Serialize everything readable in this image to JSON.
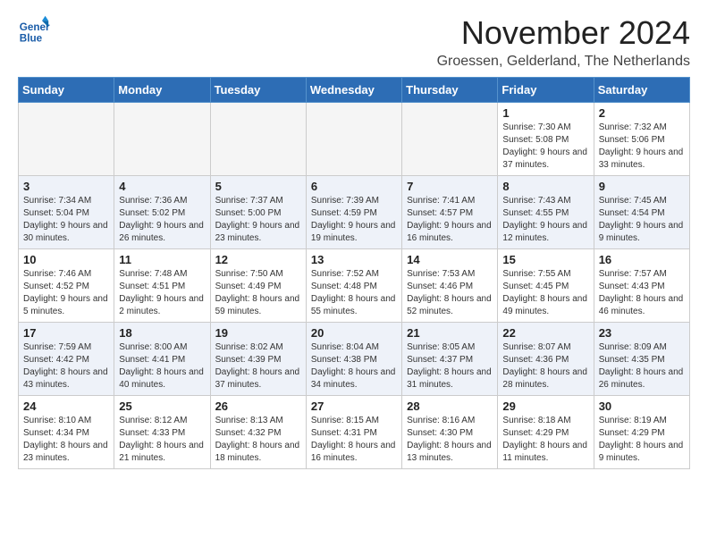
{
  "header": {
    "logo_line1": "General",
    "logo_line2": "Blue",
    "month_title": "November 2024",
    "location": "Groessen, Gelderland, The Netherlands"
  },
  "days_of_week": [
    "Sunday",
    "Monday",
    "Tuesday",
    "Wednesday",
    "Thursday",
    "Friday",
    "Saturday"
  ],
  "weeks": [
    [
      {
        "day": "",
        "empty": true
      },
      {
        "day": "",
        "empty": true
      },
      {
        "day": "",
        "empty": true
      },
      {
        "day": "",
        "empty": true
      },
      {
        "day": "",
        "empty": true
      },
      {
        "day": "1",
        "sunrise": "Sunrise: 7:30 AM",
        "sunset": "Sunset: 5:08 PM",
        "daylight": "Daylight: 9 hours and 37 minutes."
      },
      {
        "day": "2",
        "sunrise": "Sunrise: 7:32 AM",
        "sunset": "Sunset: 5:06 PM",
        "daylight": "Daylight: 9 hours and 33 minutes."
      }
    ],
    [
      {
        "day": "3",
        "sunrise": "Sunrise: 7:34 AM",
        "sunset": "Sunset: 5:04 PM",
        "daylight": "Daylight: 9 hours and 30 minutes."
      },
      {
        "day": "4",
        "sunrise": "Sunrise: 7:36 AM",
        "sunset": "Sunset: 5:02 PM",
        "daylight": "Daylight: 9 hours and 26 minutes."
      },
      {
        "day": "5",
        "sunrise": "Sunrise: 7:37 AM",
        "sunset": "Sunset: 5:00 PM",
        "daylight": "Daylight: 9 hours and 23 minutes."
      },
      {
        "day": "6",
        "sunrise": "Sunrise: 7:39 AM",
        "sunset": "Sunset: 4:59 PM",
        "daylight": "Daylight: 9 hours and 19 minutes."
      },
      {
        "day": "7",
        "sunrise": "Sunrise: 7:41 AM",
        "sunset": "Sunset: 4:57 PM",
        "daylight": "Daylight: 9 hours and 16 minutes."
      },
      {
        "day": "8",
        "sunrise": "Sunrise: 7:43 AM",
        "sunset": "Sunset: 4:55 PM",
        "daylight": "Daylight: 9 hours and 12 minutes."
      },
      {
        "day": "9",
        "sunrise": "Sunrise: 7:45 AM",
        "sunset": "Sunset: 4:54 PM",
        "daylight": "Daylight: 9 hours and 9 minutes."
      }
    ],
    [
      {
        "day": "10",
        "sunrise": "Sunrise: 7:46 AM",
        "sunset": "Sunset: 4:52 PM",
        "daylight": "Daylight: 9 hours and 5 minutes."
      },
      {
        "day": "11",
        "sunrise": "Sunrise: 7:48 AM",
        "sunset": "Sunset: 4:51 PM",
        "daylight": "Daylight: 9 hours and 2 minutes."
      },
      {
        "day": "12",
        "sunrise": "Sunrise: 7:50 AM",
        "sunset": "Sunset: 4:49 PM",
        "daylight": "Daylight: 8 hours and 59 minutes."
      },
      {
        "day": "13",
        "sunrise": "Sunrise: 7:52 AM",
        "sunset": "Sunset: 4:48 PM",
        "daylight": "Daylight: 8 hours and 55 minutes."
      },
      {
        "day": "14",
        "sunrise": "Sunrise: 7:53 AM",
        "sunset": "Sunset: 4:46 PM",
        "daylight": "Daylight: 8 hours and 52 minutes."
      },
      {
        "day": "15",
        "sunrise": "Sunrise: 7:55 AM",
        "sunset": "Sunset: 4:45 PM",
        "daylight": "Daylight: 8 hours and 49 minutes."
      },
      {
        "day": "16",
        "sunrise": "Sunrise: 7:57 AM",
        "sunset": "Sunset: 4:43 PM",
        "daylight": "Daylight: 8 hours and 46 minutes."
      }
    ],
    [
      {
        "day": "17",
        "sunrise": "Sunrise: 7:59 AM",
        "sunset": "Sunset: 4:42 PM",
        "daylight": "Daylight: 8 hours and 43 minutes."
      },
      {
        "day": "18",
        "sunrise": "Sunrise: 8:00 AM",
        "sunset": "Sunset: 4:41 PM",
        "daylight": "Daylight: 8 hours and 40 minutes."
      },
      {
        "day": "19",
        "sunrise": "Sunrise: 8:02 AM",
        "sunset": "Sunset: 4:39 PM",
        "daylight": "Daylight: 8 hours and 37 minutes."
      },
      {
        "day": "20",
        "sunrise": "Sunrise: 8:04 AM",
        "sunset": "Sunset: 4:38 PM",
        "daylight": "Daylight: 8 hours and 34 minutes."
      },
      {
        "day": "21",
        "sunrise": "Sunrise: 8:05 AM",
        "sunset": "Sunset: 4:37 PM",
        "daylight": "Daylight: 8 hours and 31 minutes."
      },
      {
        "day": "22",
        "sunrise": "Sunrise: 8:07 AM",
        "sunset": "Sunset: 4:36 PM",
        "daylight": "Daylight: 8 hours and 28 minutes."
      },
      {
        "day": "23",
        "sunrise": "Sunrise: 8:09 AM",
        "sunset": "Sunset: 4:35 PM",
        "daylight": "Daylight: 8 hours and 26 minutes."
      }
    ],
    [
      {
        "day": "24",
        "sunrise": "Sunrise: 8:10 AM",
        "sunset": "Sunset: 4:34 PM",
        "daylight": "Daylight: 8 hours and 23 minutes."
      },
      {
        "day": "25",
        "sunrise": "Sunrise: 8:12 AM",
        "sunset": "Sunset: 4:33 PM",
        "daylight": "Daylight: 8 hours and 21 minutes."
      },
      {
        "day": "26",
        "sunrise": "Sunrise: 8:13 AM",
        "sunset": "Sunset: 4:32 PM",
        "daylight": "Daylight: 8 hours and 18 minutes."
      },
      {
        "day": "27",
        "sunrise": "Sunrise: 8:15 AM",
        "sunset": "Sunset: 4:31 PM",
        "daylight": "Daylight: 8 hours and 16 minutes."
      },
      {
        "day": "28",
        "sunrise": "Sunrise: 8:16 AM",
        "sunset": "Sunset: 4:30 PM",
        "daylight": "Daylight: 8 hours and 13 minutes."
      },
      {
        "day": "29",
        "sunrise": "Sunrise: 8:18 AM",
        "sunset": "Sunset: 4:29 PM",
        "daylight": "Daylight: 8 hours and 11 minutes."
      },
      {
        "day": "30",
        "sunrise": "Sunrise: 8:19 AM",
        "sunset": "Sunset: 4:29 PM",
        "daylight": "Daylight: 8 hours and 9 minutes."
      }
    ]
  ]
}
